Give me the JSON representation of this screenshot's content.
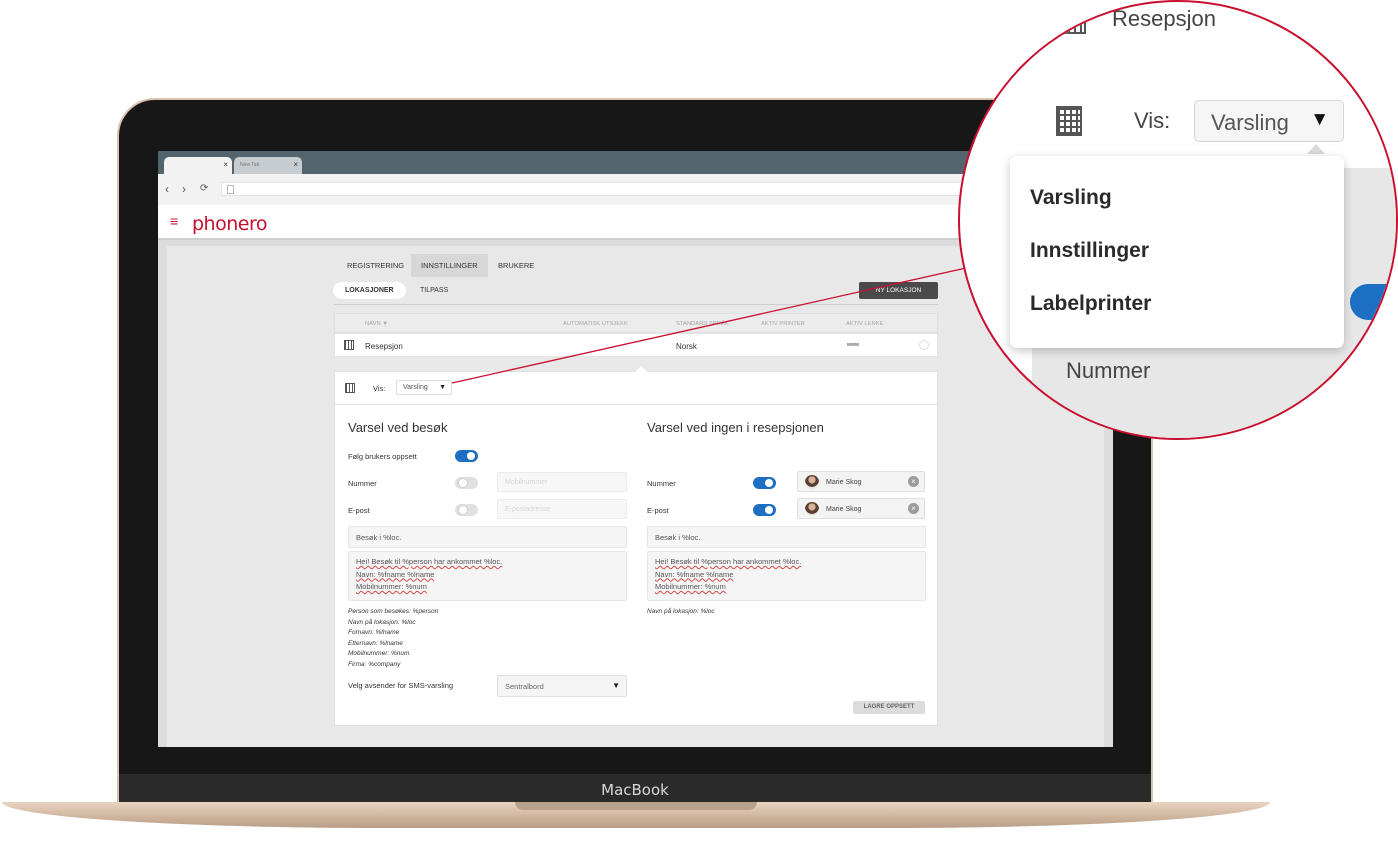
{
  "device": {
    "brand": "MacBook"
  },
  "browser": {
    "tabs": [
      {
        "label": ""
      },
      {
        "label": "New Tab"
      }
    ],
    "nav_icons": [
      "back-icon",
      "forward-icon",
      "reload-icon"
    ]
  },
  "app": {
    "logo": "phonero",
    "accent_color": "#c8102e",
    "toggle_on_color": "#1c6fc2",
    "main_tabs": [
      "REGISTRERING",
      "INNSTILLINGER",
      "BRUKERE"
    ],
    "active_main_tab": "INNSTILLINGER",
    "sub_tabs": [
      "LOKASJONER",
      "TILPASS"
    ],
    "active_sub_tab": "LOKASJONER",
    "new_location_button": "NY LOKASJON",
    "table": {
      "columns": [
        "NAVN ▼",
        "AUTOMATISK UTSJEKK",
        "STANDARD SPRÅK",
        "AKTIV PRINTER",
        "AKTIV LENKE"
      ],
      "row": {
        "name": "Resepsjon",
        "language": "Norsk",
        "link": "www"
      }
    },
    "panel": {
      "vis_label": "Vis:",
      "vis_value": "Varsling",
      "left": {
        "title": "Varsel ved besøk",
        "follow_label": "Følg brukers oppsett",
        "follow_on": true,
        "number_label": "Nummer",
        "number_on": false,
        "number_placeholder": "Mobilnummer",
        "email_label": "E-post",
        "email_on": false,
        "email_placeholder": "E-postadresse",
        "subject": "Besøk i %loc.",
        "body": [
          "Hei! Besøk til %person har ankommet %loc.",
          "Navn: %fname %lname",
          "Mobilnummer: %num"
        ],
        "help": [
          "Person som besøkes: %person",
          "Navn på lokasjon: %loc",
          "Fornavn: %fname",
          "Etternavn: %lname",
          "Mobilnummer: %num",
          "Firma: %company"
        ],
        "sms_label": "Velg avsender for SMS-varsling",
        "sms_value": "Sentralbord"
      },
      "right": {
        "title": "Varsel ved ingen i resepsjonen",
        "number_label": "Nummer",
        "number_on": true,
        "number_contact": "Marie Skog",
        "email_label": "E-post",
        "email_on": true,
        "email_contact": "Marie Skog",
        "subject": "Besøk i %loc.",
        "body": [
          "Hei! Besøk til %person har ankommet %loc.",
          "Navn: %fname %lname",
          "Mobilnummer: %num"
        ],
        "help": [
          "Navn på lokasjon: %loc"
        ]
      },
      "save_button": "LAGRE OPPSETT"
    }
  },
  "zoom": {
    "location": "Resepsjon",
    "vis_label": "Vis:",
    "vis_value": "Varsling",
    "menu": [
      "Varsling",
      "Innstillinger",
      "Labelprinter"
    ],
    "number_label": "Nummer"
  }
}
